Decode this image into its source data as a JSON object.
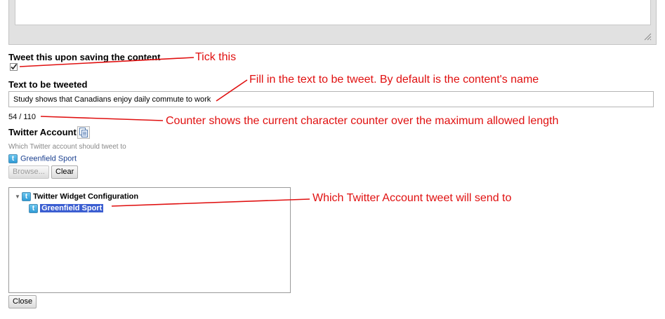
{
  "tweet_option": {
    "label": "Tweet this upon saving the content",
    "checked": true
  },
  "tweet_text": {
    "label": "Text to be tweeted",
    "value": "Study shows that Canadians enjoy daily commute to work",
    "counter": "54 / 110"
  },
  "twitter_account": {
    "label": "Twitter Account",
    "hint": "Which Twitter account should tweet to",
    "selected_account": "Greenfield Sport",
    "browse_label": "Browse...",
    "clear_label": "Clear"
  },
  "tree": {
    "root_label": "Twitter Widget Configuration",
    "child_label": "Greenfield Sport"
  },
  "close_label": "Close",
  "annotations": {
    "tick": "Tick this",
    "fill": "Fill in the text to be tweet. By default is the content's name",
    "counter": "Counter shows the current character counter over the maximum allowed length",
    "account": "Which Twitter Account tweet will send to"
  },
  "colors": {
    "annotation": "#e01010",
    "selection": "#3b5ed1",
    "link": "#1a3f8f"
  }
}
